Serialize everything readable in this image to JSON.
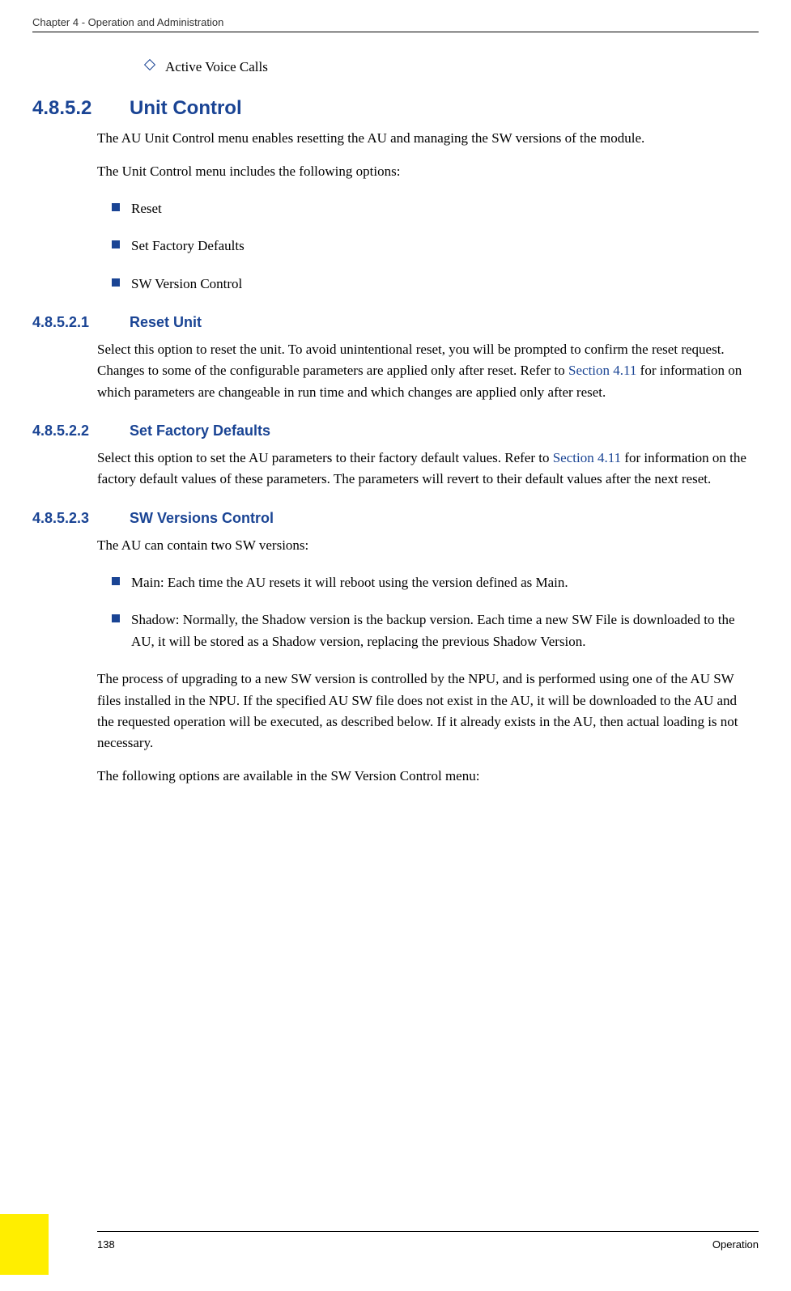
{
  "header": {
    "chapter": "Chapter 4 - Operation and Administration"
  },
  "content": {
    "diamond_item": "Active Voice Calls",
    "sec_4852": {
      "number": "4.8.5.2",
      "title": "Unit Control",
      "para1": "The AU Unit Control menu enables resetting the AU and managing the SW versions of the module.",
      "para2": "The Unit Control menu includes the following options:",
      "bullets": {
        "b1": "Reset",
        "b2": "Set Factory Defaults",
        "b3": "SW Version Control"
      }
    },
    "sec_48521": {
      "number": "4.8.5.2.1",
      "title": "Reset Unit",
      "para_pre": "Select this option to reset the unit. To avoid unintentional reset, you will be prompted to confirm the reset request. Changes to some of the configurable parameters are applied only after reset. Refer to ",
      "link": "Section 4.11",
      "para_post": " for information on which parameters are changeable in run time and which changes are applied only after reset."
    },
    "sec_48522": {
      "number": "4.8.5.2.2",
      "title": "Set Factory Defaults",
      "para_pre": "Select this option to set the AU parameters to their factory default values. Refer to ",
      "link": "Section 4.11",
      "para_post": " for information on the factory default values of these parameters. The parameters will revert to their default values after the next reset."
    },
    "sec_48523": {
      "number": "4.8.5.2.3",
      "title": "SW Versions Control",
      "para1": "The AU can contain two SW versions:",
      "bullets": {
        "b1": "Main: Each time the AU resets it will reboot using the version defined as Main.",
        "b2": "Shadow: Normally, the Shadow version is the backup version. Each time a new SW File is downloaded to the AU, it will be stored as a Shadow version, replacing the previous Shadow Version."
      },
      "para2": "The process of upgrading to a new SW version is controlled by the NPU, and is performed using one of the AU SW files installed in the NPU. If the specified AU SW file does not exist in the AU, it will be downloaded to the AU and the requested operation will be executed, as described below. If it already exists in the AU, then actual loading is not necessary.",
      "para3": "The following options are available in the SW Version Control menu:"
    }
  },
  "footer": {
    "page": "138",
    "label": "Operation"
  }
}
